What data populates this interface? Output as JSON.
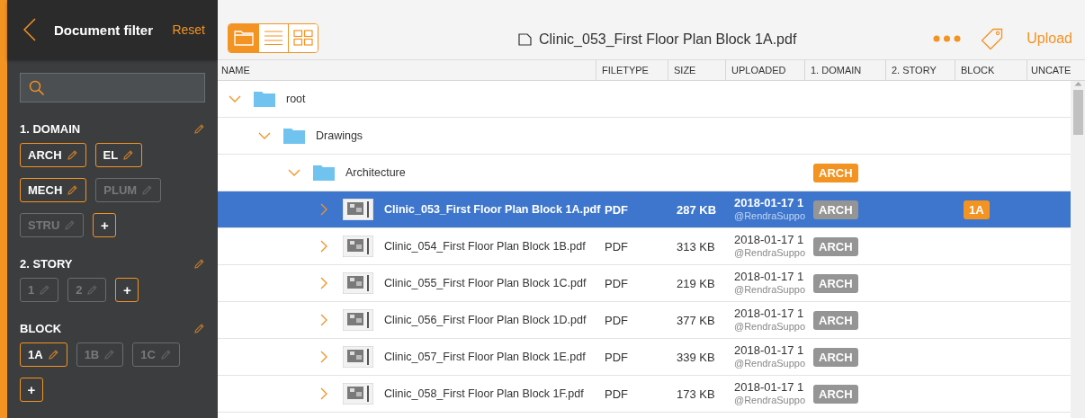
{
  "sidebar": {
    "title": "Document filter",
    "reset": "Reset",
    "sections": [
      {
        "title": "1. DOMAIN",
        "tags": [
          {
            "label": "ARCH",
            "selected": true
          },
          {
            "label": "EL",
            "selected": true
          },
          {
            "label": "MECH",
            "selected": true
          },
          {
            "label": "PLUM",
            "selected": false
          },
          {
            "label": "STRU",
            "selected": false
          }
        ],
        "add": "+"
      },
      {
        "title": "2. STORY",
        "tags": [
          {
            "label": "1",
            "selected": false
          },
          {
            "label": "2",
            "selected": false
          }
        ],
        "add": "+"
      },
      {
        "title": "BLOCK",
        "tags": [
          {
            "label": "1A",
            "selected": true
          },
          {
            "label": "1B",
            "selected": false
          },
          {
            "label": "1C",
            "selected": false
          }
        ],
        "add": "+"
      }
    ]
  },
  "toolbar": {
    "views": [
      {
        "kind": "folder",
        "selected": true
      },
      {
        "kind": "list",
        "selected": false
      },
      {
        "kind": "grid",
        "selected": false
      }
    ],
    "title": "Clinic_053_First Floor Plan Block 1A.pdf",
    "upload": "Upload"
  },
  "table": {
    "columns": [
      "NAME",
      "FILETYPE",
      "SIZE",
      "UPLOADED",
      "1. DOMAIN",
      "2. STORY",
      "BLOCK",
      "UNCATE"
    ],
    "tree": [
      {
        "kind": "folder",
        "name": "root",
        "expanded": true,
        "children": [
          {
            "kind": "folder",
            "name": "Drawings",
            "expanded": true,
            "children": [
              {
                "kind": "folder",
                "name": "Architecture",
                "expanded": true,
                "domain": {
                  "label": "ARCH",
                  "active": true
                },
                "children": [
                  {
                    "kind": "file",
                    "name": "Clinic_053_First Floor Plan Block 1A.pdf",
                    "expanded": false,
                    "selected": true,
                    "filetype": "PDF",
                    "size": "287 KB",
                    "uploaded": "2018-01-17 1",
                    "uploader": "@RendraSuppo",
                    "domain": {
                      "label": "ARCH",
                      "active": false
                    },
                    "block": {
                      "label": "1A",
                      "active": true
                    }
                  },
                  {
                    "kind": "file",
                    "name": "Clinic_054_First Floor Plan Block 1B.pdf",
                    "expanded": false,
                    "selected": false,
                    "filetype": "PDF",
                    "size": "313 KB",
                    "uploaded": "2018-01-17 1",
                    "uploader": "@RendraSuppo",
                    "domain": {
                      "label": "ARCH",
                      "active": false
                    }
                  },
                  {
                    "kind": "file",
                    "name": "Clinic_055_First Floor Plan Block 1C.pdf",
                    "expanded": false,
                    "selected": false,
                    "filetype": "PDF",
                    "size": "219 KB",
                    "uploaded": "2018-01-17 1",
                    "uploader": "@RendraSuppo",
                    "domain": {
                      "label": "ARCH",
                      "active": false
                    }
                  },
                  {
                    "kind": "file",
                    "name": "Clinic_056_First Floor Plan Block 1D.pdf",
                    "expanded": false,
                    "selected": false,
                    "filetype": "PDF",
                    "size": "377 KB",
                    "uploaded": "2018-01-17 1",
                    "uploader": "@RendraSuppo",
                    "domain": {
                      "label": "ARCH",
                      "active": false
                    }
                  },
                  {
                    "kind": "file",
                    "name": "Clinic_057_First Floor Plan Block 1E.pdf",
                    "expanded": false,
                    "selected": false,
                    "filetype": "PDF",
                    "size": "339 KB",
                    "uploaded": "2018-01-17 1",
                    "uploader": "@RendraSuppo",
                    "domain": {
                      "label": "ARCH",
                      "active": false
                    }
                  },
                  {
                    "kind": "file",
                    "name": "Clinic_058_First Floor Plan Block 1F.pdf",
                    "expanded": false,
                    "selected": false,
                    "filetype": "PDF",
                    "size": "173 KB",
                    "uploaded": "2018-01-17 1",
                    "uploader": "@RendraSuppo",
                    "domain": {
                      "label": "ARCH",
                      "active": false
                    }
                  }
                ]
              }
            ]
          }
        ]
      }
    ]
  }
}
